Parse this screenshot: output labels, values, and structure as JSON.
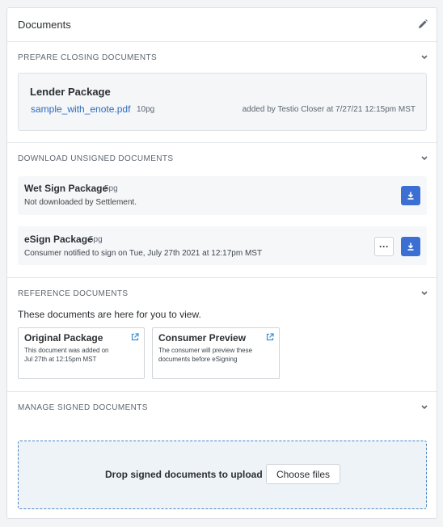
{
  "panel": {
    "title": "Documents"
  },
  "prepare": {
    "label": "PREPARE CLOSING DOCUMENTS",
    "package_title": "Lender Package",
    "file_name": "sample_with_enote.pdf",
    "file_pages": "10pg",
    "added_by": "added by Testio Closer at 7/27/21 12:15pm MST"
  },
  "download": {
    "label": "DOWNLOAD UNSIGNED DOCUMENTS",
    "packages": [
      {
        "title": "Wet Sign Package",
        "pages": "5pg",
        "status": "Not downloaded by Settlement."
      },
      {
        "title": "eSign Package",
        "pages": "5pg",
        "status": "Consumer notified to sign on Tue, July 27th 2021 at 12:17pm MST"
      }
    ],
    "more_label": "···"
  },
  "reference": {
    "label": "REFERENCE DOCUMENTS",
    "intro": "These documents are here for you to view.",
    "cards": [
      {
        "title": "Original Package",
        "desc_line1": "This document was added on",
        "desc_line2": "Jul 27th at 12:15pm MST"
      },
      {
        "title": "Consumer Preview",
        "desc_line1": "The consumer will preview these",
        "desc_line2": "documents before eSigning"
      }
    ]
  },
  "manage": {
    "label": "MANAGE SIGNED DOCUMENTS",
    "drop_text": "Drop signed documents to upload",
    "choose_label": "Choose files"
  },
  "colors": {
    "accent": "#3b6fd4",
    "link": "#2f6bbf",
    "drop_border": "#4a86c5",
    "drop_bg": "#eef3f7"
  },
  "icons": {
    "edit": "pencil-icon",
    "collapse": "chevron-down-icon",
    "download": "download-icon",
    "external": "external-link-icon"
  }
}
